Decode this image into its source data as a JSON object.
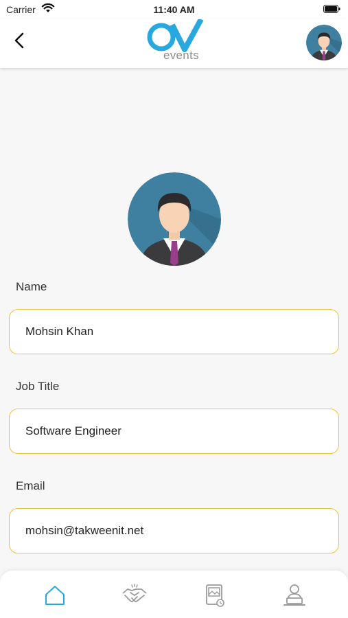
{
  "status_bar": {
    "carrier": "Carrier",
    "time": "11:40 AM"
  },
  "header": {
    "logo_text": "events",
    "back_icon": "chevron-left-icon",
    "avatar_icon": "user-avatar-icon"
  },
  "form": {
    "name": {
      "label": "Name",
      "value": "Mohsin Khan"
    },
    "job_title": {
      "label": "Job Title",
      "value": "Software Engineer"
    },
    "email": {
      "label": "Email",
      "value": "mohsin@takweenit.net"
    }
  },
  "tab_bar": {
    "items": [
      {
        "icon": "home-icon",
        "active": true
      },
      {
        "icon": "handshake-icon",
        "active": false
      },
      {
        "icon": "gallery-icon",
        "active": false
      },
      {
        "icon": "profile-laptop-icon",
        "active": false
      }
    ]
  },
  "colors": {
    "accent": "#29a8e0",
    "input_border": "#f2c23e",
    "avatar_bg": "#3f7fa0"
  }
}
